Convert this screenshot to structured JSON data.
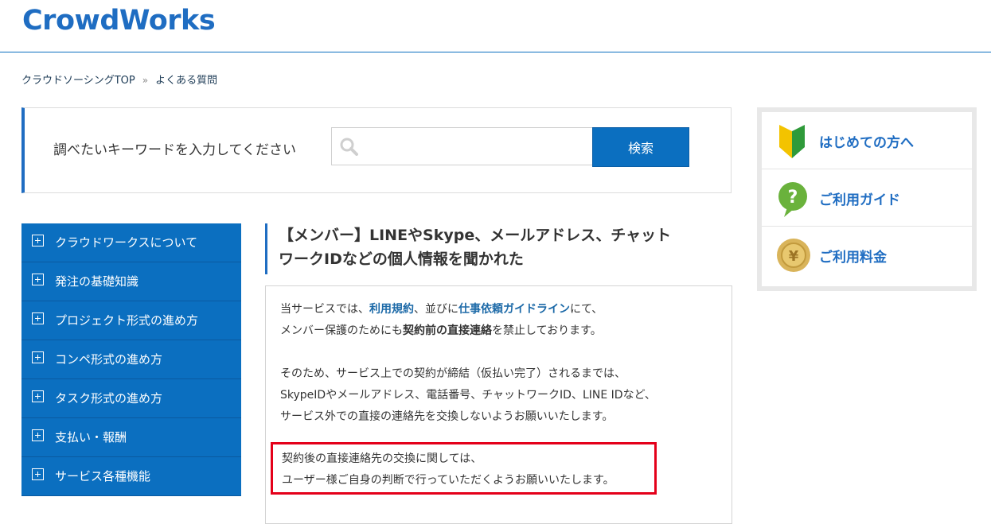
{
  "header": {
    "logo": "CrowdWorks"
  },
  "breadcrumb": {
    "home": "クラウドソーシングTOP",
    "separator": "»",
    "current": "よくある質問"
  },
  "search": {
    "label": "調べたいキーワードを入力してください",
    "placeholder": "",
    "value": "",
    "button": "検索"
  },
  "side_menu": {
    "items": [
      {
        "label": "クラウドワークスについて"
      },
      {
        "label": "発注の基礎知識"
      },
      {
        "label": "プロジェクト形式の進め方"
      },
      {
        "label": "コンペ形式の進め方"
      },
      {
        "label": "タスク形式の進め方"
      },
      {
        "label": "支払い・報酬"
      },
      {
        "label": "サービス各種機能"
      }
    ]
  },
  "article": {
    "title_line1": "【メンバー】LINEやSkype、メールアドレス、チャット",
    "title_line2": "ワークIDなどの個人情報を聞かれた",
    "p1": {
      "t1": "当サービスでは、",
      "link1": "利用規約",
      "t2": "、並びに",
      "link2": "仕事依頼ガイドライン",
      "t3": "にて、",
      "t4": "メンバー保護のためにも",
      "bold1": "契約前の直接連絡",
      "t5": "を禁止しております。"
    },
    "p2": {
      "line1": "そのため、サービス上での契約が締結（仮払い完了）されるまでは、",
      "line2": "SkypeIDやメールアドレス、電話番号、チャットワークID、LINE IDなど、",
      "line3": "サービス外での直接の連絡先を交換しないようお願いいたします。"
    },
    "p3": {
      "line1": "契約後の直接連絡先の交換に関しては、",
      "line2": "ユーザー様ご自身の判断で行っていただくようお願いいたします。"
    }
  },
  "right_panel": {
    "items": [
      {
        "label": "はじめての方へ",
        "icon": "beginner-leaf-icon"
      },
      {
        "label": "ご利用ガイド",
        "icon": "question-bubble-icon"
      },
      {
        "label": "ご利用料金",
        "icon": "yen-coin-icon"
      }
    ]
  },
  "colors": {
    "brand": "#0b6fc0",
    "highlight_border": "#e4001a",
    "link": "#1d6aa8"
  }
}
